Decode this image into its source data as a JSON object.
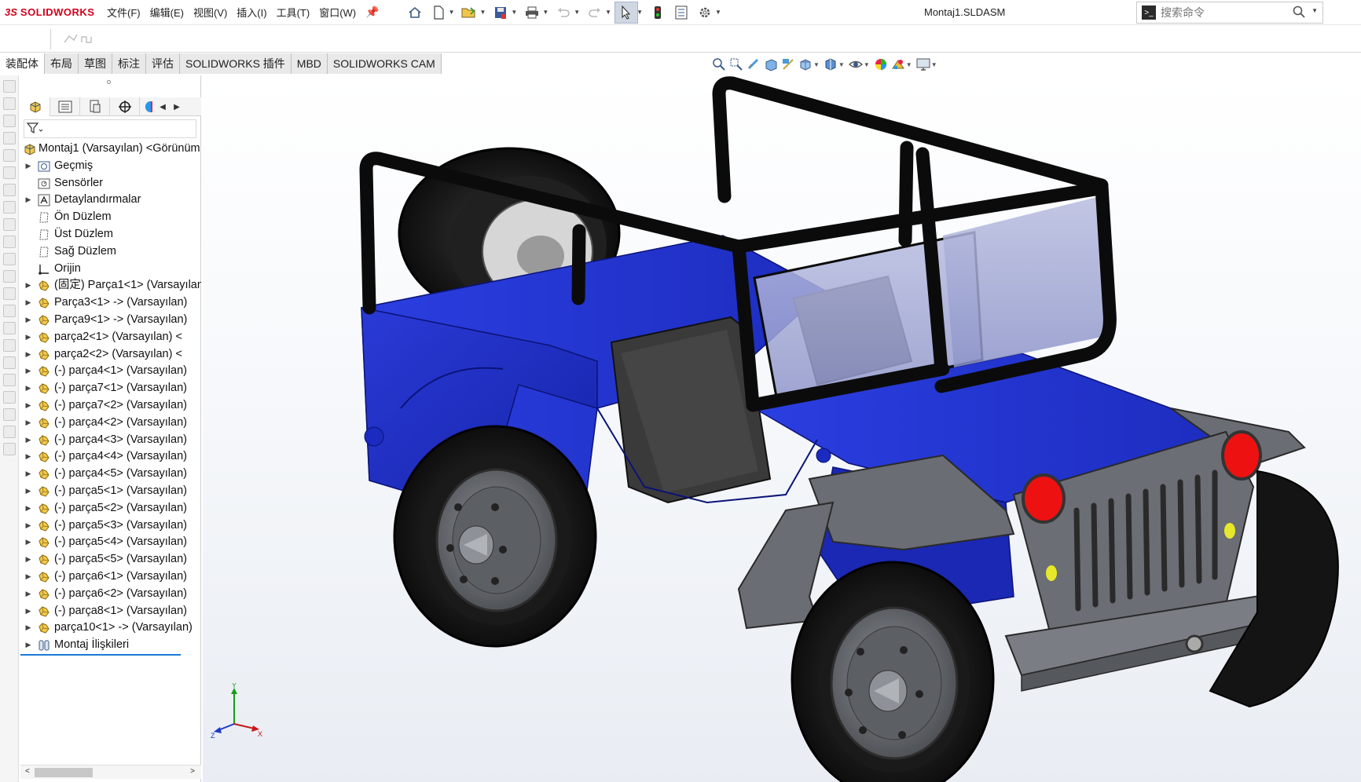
{
  "app": {
    "logo_prefix": "3S",
    "logo_text": "SOLIDWORKS",
    "document_title": "Montaj1.SLDASM"
  },
  "menu": {
    "items": [
      "文件(F)",
      "编辑(E)",
      "视图(V)",
      "插入(I)",
      "工具(T)",
      "窗口(W)"
    ]
  },
  "search": {
    "placeholder": "搜索命令"
  },
  "command_tabs": [
    {
      "label": "装配体",
      "active": true
    },
    {
      "label": "布局",
      "active": false
    },
    {
      "label": "草图",
      "active": false
    },
    {
      "label": "标注",
      "active": false
    },
    {
      "label": "评估",
      "active": false
    },
    {
      "label": "SOLIDWORKS 插件",
      "active": false
    },
    {
      "label": "MBD",
      "active": false
    },
    {
      "label": "SOLIDWORKS CAM",
      "active": false
    }
  ],
  "feature_tree": {
    "root": "Montaj1 (Varsayılan) <Görünüm",
    "nodes": [
      {
        "label": "Geçmiş",
        "icon": "history-icon",
        "expandable": true
      },
      {
        "label": "Sensörler",
        "icon": "sensor-icon",
        "expandable": false
      },
      {
        "label": "Detaylandırmalar",
        "icon": "annotation-icon",
        "expandable": true
      },
      {
        "label": "Ön Düzlem",
        "icon": "plane-icon",
        "expandable": false
      },
      {
        "label": "Üst Düzlem",
        "icon": "plane-icon",
        "expandable": false
      },
      {
        "label": "Sağ Düzlem",
        "icon": "plane-icon",
        "expandable": false
      },
      {
        "label": "Orijin",
        "icon": "origin-icon",
        "expandable": false
      },
      {
        "label": "(固定) Parça1<1> (Varsayılan)",
        "icon": "part-icon",
        "expandable": true
      },
      {
        "label": "Parça3<1> -> (Varsayılan)",
        "icon": "part-icon",
        "expandable": true
      },
      {
        "label": "Parça9<1> -> (Varsayılan)",
        "icon": "part-icon",
        "expandable": true
      },
      {
        "label": "parça2<1> (Varsayılan) <",
        "icon": "part-icon",
        "expandable": true
      },
      {
        "label": "parça2<2> (Varsayılan) <",
        "icon": "part-icon",
        "expandable": true
      },
      {
        "label": "(-) parça4<1> (Varsayılan)",
        "icon": "part-icon",
        "expandable": true
      },
      {
        "label": "(-) parça7<1> (Varsayılan)",
        "icon": "part-icon",
        "expandable": true
      },
      {
        "label": "(-) parça7<2> (Varsayılan)",
        "icon": "part-icon",
        "expandable": true
      },
      {
        "label": "(-) parça4<2> (Varsayılan)",
        "icon": "part-icon",
        "expandable": true
      },
      {
        "label": "(-) parça4<3> (Varsayılan)",
        "icon": "part-icon",
        "expandable": true
      },
      {
        "label": "(-) parça4<4> (Varsayılan)",
        "icon": "part-icon",
        "expandable": true
      },
      {
        "label": "(-) parça4<5> (Varsayılan)",
        "icon": "part-icon",
        "expandable": true
      },
      {
        "label": "(-) parça5<1> (Varsayılan)",
        "icon": "part-icon",
        "expandable": true
      },
      {
        "label": "(-) parça5<2> (Varsayılan)",
        "icon": "part-icon",
        "expandable": true
      },
      {
        "label": "(-) parça5<3> (Varsayılan)",
        "icon": "part-icon",
        "expandable": true
      },
      {
        "label": "(-) parça5<4> (Varsayılan)",
        "icon": "part-icon",
        "expandable": true
      },
      {
        "label": "(-) parça5<5> (Varsayılan)",
        "icon": "part-icon",
        "expandable": true
      },
      {
        "label": "(-) parça6<1> (Varsayılan)",
        "icon": "part-icon",
        "expandable": true
      },
      {
        "label": "(-) parça6<2> (Varsayılan)",
        "icon": "part-icon",
        "expandable": true
      },
      {
        "label": "(-) parça8<1> (Varsayılan)",
        "icon": "part-icon",
        "expandable": true
      },
      {
        "label": "parça10<1> -> (Varsayılan)",
        "icon": "part-icon",
        "expandable": true
      },
      {
        "label": "Montaj İlişkileri",
        "icon": "mates-icon",
        "expandable": true
      }
    ]
  },
  "triad": {
    "x": "X",
    "y": "Y",
    "z": "Z"
  },
  "colors": {
    "brand_red": "#d0021b",
    "body_blue": "#1f2fbf",
    "frame_black": "#0b0b0b",
    "fender_gray": "#6a6d73",
    "selection_blue": "#1a7ad6"
  }
}
